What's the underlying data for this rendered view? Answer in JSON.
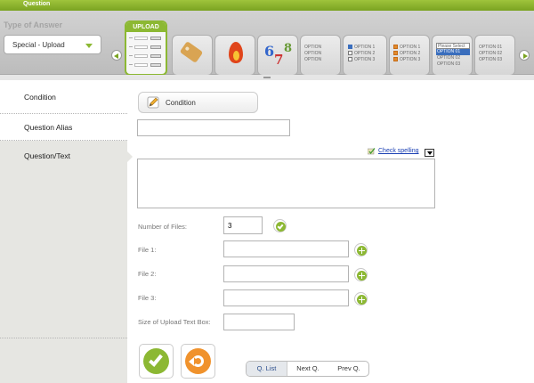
{
  "titlebar": {
    "title": "Question"
  },
  "answer_type": {
    "label": "Type of Answer",
    "selected": "Special - Upload"
  },
  "thumbnails": {
    "upload": {
      "label": "UPLOAD",
      "rows": [
        "File 1",
        "File 2",
        "File 3",
        "File 4"
      ],
      "button": "Browse"
    },
    "numbers": [
      "6",
      "7",
      "8"
    ],
    "option_stepper": {
      "options": [
        "OPTION",
        "OPTION",
        "OPTION"
      ]
    },
    "checkboxes": {
      "options": [
        "OPTION 1",
        "OPTION 2",
        "OPTION 3"
      ]
    },
    "orange_checkboxes": {
      "options": [
        "OPTION 1",
        "OPTION 2",
        "OPTION 3"
      ]
    },
    "select_list": {
      "header": "Please Select",
      "options": [
        "OPTION 01",
        "OPTION 02",
        "OPTION 03"
      ]
    },
    "stepper_list": {
      "options": [
        "OPTION 01",
        "OPTION 02",
        "OPTION 03"
      ]
    }
  },
  "sidebar": {
    "items": [
      {
        "label": "Condition"
      },
      {
        "label": "Question Alias"
      },
      {
        "label": "Question/Text"
      }
    ]
  },
  "form": {
    "condition_button": "Condition",
    "question_alias_value": "",
    "check_spelling": "Check spelling",
    "question_text_value": "",
    "number_of_files_label": "Number of Files:",
    "number_of_files_value": "3",
    "file1_label": "File 1:",
    "file2_label": "File 2:",
    "file3_label": "File 3:",
    "file1_value": "",
    "file2_value": "",
    "file3_value": "",
    "size_label": "Size of Upload Text Box:",
    "size_value": ""
  },
  "nav": {
    "list": "Q. List",
    "next": "Next Q.",
    "prev": "Prev Q."
  },
  "colors": {
    "accent": "#8cb833",
    "orange": "#f0922c",
    "link": "#1a3fb3"
  }
}
